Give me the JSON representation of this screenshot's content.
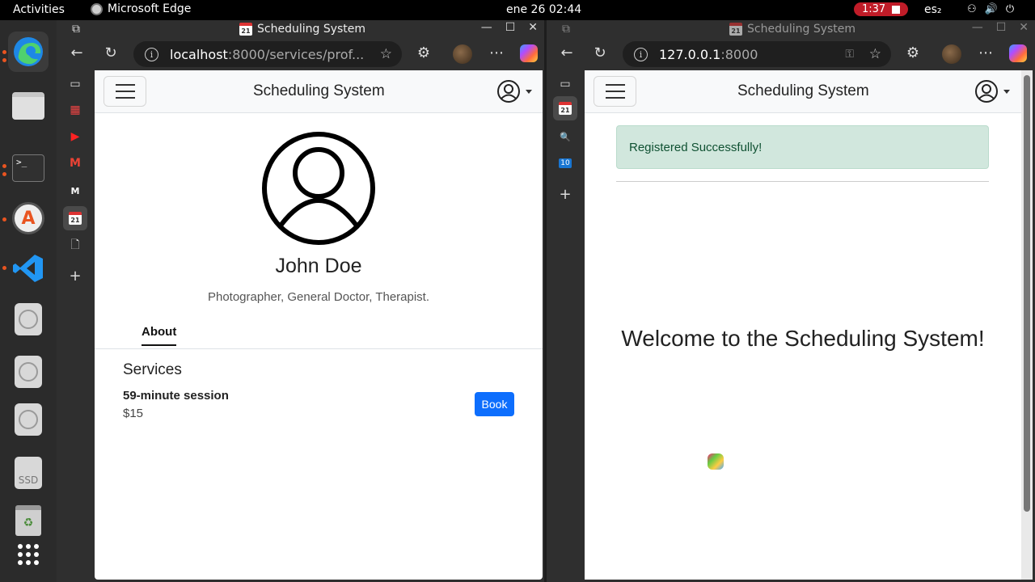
{
  "topbar": {
    "activities": "Activities",
    "app_name": "Microsoft Edge",
    "clock": "ene 26  02:44",
    "recording_time": "1:37",
    "language": "es₂",
    "system_icons": [
      "network-icon",
      "volume-icon",
      "power-icon"
    ]
  },
  "dock": {
    "items": [
      "edge-icon",
      "files-icon",
      "terminal-icon",
      "software-updater-icon",
      "vscode-icon",
      "disc-icon",
      "disc-icon",
      "disc-icon",
      "ssd-drive-icon",
      "trash-icon",
      "app-grid-icon"
    ],
    "ssd_label": "SSD"
  },
  "left_window": {
    "tab_title": "Scheduling System",
    "url_host": "localhost",
    "url_rest": ":8000/services/prof...",
    "calendar_day": "21",
    "app": {
      "brand": "Scheduling System",
      "profile_name": "John Doe",
      "profile_subtitle": "Photographer, General Doctor, Therapist.",
      "tab_about": "About",
      "services_heading": "Services",
      "services": [
        {
          "name": "59-minute session",
          "price": "$15",
          "action": "Book"
        }
      ]
    }
  },
  "right_window": {
    "tab_title": "Scheduling System",
    "url_host": "127.0.0.1",
    "url_rest": ":8000",
    "calendar_day": "21",
    "outlook_badge": "10",
    "app": {
      "brand": "Scheduling System",
      "alert": "Registered Successfully!",
      "welcome": "Welcome to the Scheduling System!"
    }
  },
  "colors": {
    "primary_button": "#0d6efd",
    "success_alert_bg": "#d1e7dd",
    "recording_badge": "#c01c28"
  }
}
